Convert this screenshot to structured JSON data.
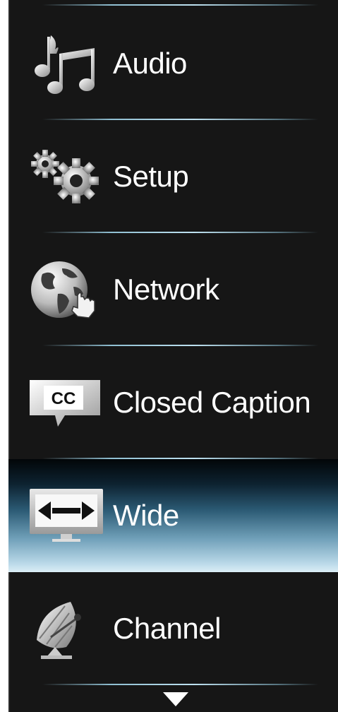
{
  "menu": {
    "items": [
      {
        "label": "Audio",
        "icon": "music-note-icon",
        "selected": false
      },
      {
        "label": "Setup",
        "icon": "gears-icon",
        "selected": false
      },
      {
        "label": "Network",
        "icon": "globe-hand-icon",
        "selected": false
      },
      {
        "label": "Closed Caption",
        "icon": "closed-caption-icon",
        "selected": false
      },
      {
        "label": "Wide",
        "icon": "widescreen-icon",
        "selected": true
      },
      {
        "label": "Channel",
        "icon": "satellite-dish-icon",
        "selected": false
      }
    ],
    "scroll_indicator": "arrow-down-icon"
  },
  "colors": {
    "background": "#161616",
    "text": "#ffffff",
    "separator": "#a8d2e4",
    "selected_highlight_top": "#0d2230",
    "selected_highlight_bottom": "#dbeef6"
  }
}
